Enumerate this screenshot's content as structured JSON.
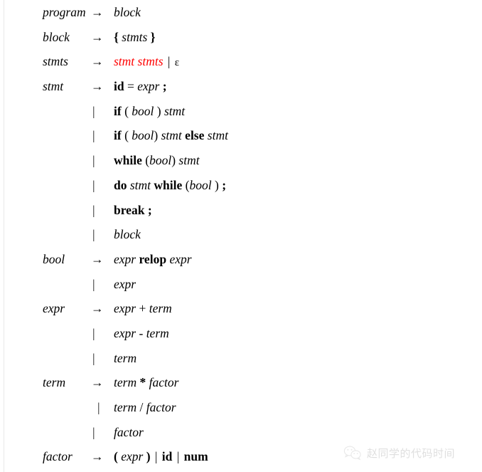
{
  "document": {
    "kind": "context-free-grammar",
    "colors": {
      "text": "#000000",
      "highlight": "#ff0000",
      "watermark": "#b5b5b5",
      "rule": "#e8e8e8",
      "background": "#ffffff"
    },
    "symbols": {
      "arrow": "→",
      "bar": "|",
      "epsilon": "ε"
    }
  },
  "productions": [
    {
      "lhs": "program",
      "op": "→",
      "op_kind": "arrow",
      "tokens": [
        {
          "text": "block",
          "style": "nt"
        }
      ]
    },
    {
      "lhs": "block",
      "op": "→",
      "op_kind": "arrow",
      "tokens": [
        {
          "text": "{",
          "style": "tm"
        },
        {
          "text": " ",
          "style": "pl"
        },
        {
          "text": "stmts",
          "style": "nt"
        },
        {
          "text": " ",
          "style": "pl"
        },
        {
          "text": "}",
          "style": "tm"
        }
      ]
    },
    {
      "lhs": "stmts",
      "op": "→",
      "op_kind": "arrow",
      "tokens": [
        {
          "text": "stmt stmts",
          "style": "hl"
        },
        {
          "text": " ",
          "style": "pl"
        },
        {
          "text": "|",
          "style": "alt-bar"
        },
        {
          "text": " ",
          "style": "pl"
        },
        {
          "text": "ε",
          "style": "eps"
        }
      ]
    },
    {
      "lhs": "stmt",
      "op": "→",
      "op_kind": "arrow",
      "tokens": [
        {
          "text": "id",
          "style": "tm"
        },
        {
          "text": " = ",
          "style": "pl"
        },
        {
          "text": "expr",
          "style": "nt"
        },
        {
          "text": " ",
          "style": "pl"
        },
        {
          "text": ";",
          "style": "tm"
        }
      ]
    },
    {
      "lhs": "",
      "op": "|",
      "op_kind": "bar",
      "tokens": [
        {
          "text": "if",
          "style": "kw"
        },
        {
          "text": " ( ",
          "style": "pl"
        },
        {
          "text": "bool",
          "style": "nt"
        },
        {
          "text": " ) ",
          "style": "pl"
        },
        {
          "text": "stmt",
          "style": "nt"
        }
      ]
    },
    {
      "lhs": "",
      "op": "|",
      "op_kind": "bar",
      "tokens": [
        {
          "text": "if",
          "style": "kw"
        },
        {
          "text": " ( ",
          "style": "pl"
        },
        {
          "text": "bool",
          "style": "nt"
        },
        {
          "text": ") ",
          "style": "pl"
        },
        {
          "text": "stmt",
          "style": "nt"
        },
        {
          "text": " ",
          "style": "pl"
        },
        {
          "text": "else",
          "style": "kw"
        },
        {
          "text": " ",
          "style": "pl"
        },
        {
          "text": "stmt",
          "style": "nt"
        }
      ]
    },
    {
      "lhs": "",
      "op": "|",
      "op_kind": "bar",
      "tokens": [
        {
          "text": "while",
          "style": "kw"
        },
        {
          "text": " (",
          "style": "pl"
        },
        {
          "text": "bool",
          "style": "nt"
        },
        {
          "text": ") ",
          "style": "pl"
        },
        {
          "text": "stmt",
          "style": "nt"
        }
      ]
    },
    {
      "lhs": "",
      "op": "|",
      "op_kind": "bar",
      "tokens": [
        {
          "text": "do",
          "style": "kw"
        },
        {
          "text": " ",
          "style": "pl"
        },
        {
          "text": "stmt",
          "style": "nt"
        },
        {
          "text": " ",
          "style": "pl"
        },
        {
          "text": "while",
          "style": "kw"
        },
        {
          "text": " (",
          "style": "pl"
        },
        {
          "text": "bool",
          "style": "nt"
        },
        {
          "text": " ) ",
          "style": "pl"
        },
        {
          "text": ";",
          "style": "tm"
        }
      ]
    },
    {
      "lhs": "",
      "op": "|",
      "op_kind": "bar",
      "tokens": [
        {
          "text": "break",
          "style": "kw"
        },
        {
          "text": " ",
          "style": "pl"
        },
        {
          "text": ";",
          "style": "tm"
        }
      ]
    },
    {
      "lhs": "",
      "op": "|",
      "op_kind": "bar",
      "tokens": [
        {
          "text": "block",
          "style": "nt"
        }
      ]
    },
    {
      "lhs": "bool",
      "op": "→",
      "op_kind": "arrow",
      "tokens": [
        {
          "text": "expr",
          "style": "nt"
        },
        {
          "text": " ",
          "style": "pl"
        },
        {
          "text": "relop",
          "style": "kw"
        },
        {
          "text": " ",
          "style": "pl"
        },
        {
          "text": "expr",
          "style": "nt"
        }
      ]
    },
    {
      "lhs": "",
      "op": "|",
      "op_kind": "bar",
      "tokens": [
        {
          "text": "expr",
          "style": "nt"
        }
      ]
    },
    {
      "lhs": "expr",
      "op": "→",
      "op_kind": "arrow",
      "tokens": [
        {
          "text": "expr",
          "style": "nt"
        },
        {
          "text": " + ",
          "style": "pl"
        },
        {
          "text": "term",
          "style": "nt"
        }
      ]
    },
    {
      "lhs": "",
      "op": "|",
      "op_kind": "bar",
      "tokens": [
        {
          "text": "expr",
          "style": "nt"
        },
        {
          "text": " - ",
          "style": "pl"
        },
        {
          "text": "term",
          "style": "nt"
        }
      ]
    },
    {
      "lhs": "",
      "op": "|",
      "op_kind": "bar",
      "tokens": [
        {
          "text": "term",
          "style": "nt"
        }
      ]
    },
    {
      "lhs": "term",
      "op": "→",
      "op_kind": "arrow",
      "tokens": [
        {
          "text": "term",
          "style": "nt"
        },
        {
          "text": " ",
          "style": "pl"
        },
        {
          "text": "*",
          "style": "tm"
        },
        {
          "text": " ",
          "style": "pl"
        },
        {
          "text": "factor",
          "style": "nt"
        }
      ]
    },
    {
      "lhs": "",
      "op": "|",
      "op_kind": "bar",
      "op_indent": true,
      "tokens": [
        {
          "text": "term",
          "style": "nt"
        },
        {
          "text": " / ",
          "style": "pl"
        },
        {
          "text": "factor",
          "style": "nt"
        }
      ]
    },
    {
      "lhs": "",
      "op": "|",
      "op_kind": "bar",
      "tokens": [
        {
          "text": "factor",
          "style": "nt"
        }
      ]
    },
    {
      "lhs": "factor",
      "op": "→",
      "op_kind": "arrow",
      "tokens": [
        {
          "text": "( ",
          "style": "tm"
        },
        {
          "text": "expr",
          "style": "nt"
        },
        {
          "text": " )",
          "style": "tm"
        },
        {
          "text": " ",
          "style": "pl"
        },
        {
          "text": "|",
          "style": "alt-bar"
        },
        {
          "text": " ",
          "style": "pl"
        },
        {
          "text": "id",
          "style": "tm"
        },
        {
          "text": " ",
          "style": "pl"
        },
        {
          "text": "|",
          "style": "alt-bar"
        },
        {
          "text": " ",
          "style": "pl"
        },
        {
          "text": "num",
          "style": "tm"
        }
      ]
    }
  ],
  "watermark": {
    "icon": "wechat-icon",
    "text": "赵同学的代码时间"
  }
}
